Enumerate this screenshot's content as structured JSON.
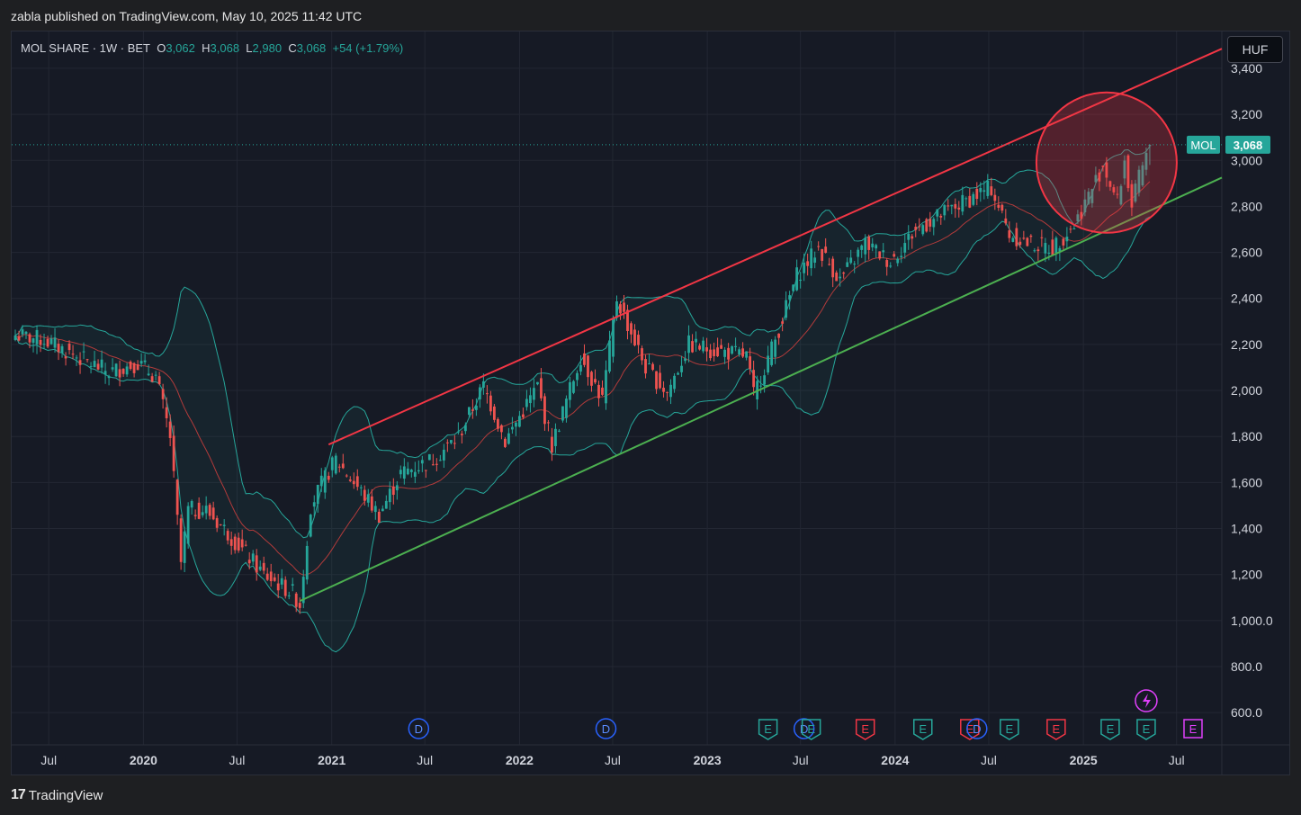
{
  "header": {
    "published": "zabla published on TradingView.com, May 10, 2025 11:42 UTC"
  },
  "legend": {
    "symbol": "MOL SHARE · 1W · BET",
    "o_label": "O",
    "o": "3,062",
    "h_label": "H",
    "h": "3,068",
    "l_label": "L",
    "l": "2,980",
    "c_label": "C",
    "c": "3,068",
    "change": "+54 (+1.79%)"
  },
  "currency_button": "HUF",
  "price_tag": {
    "symbol": "MOL",
    "value": "3,068"
  },
  "brand": "TradingView",
  "colors": {
    "up": "#26a69a",
    "down": "#ef5350",
    "channel_top": "#f23645",
    "channel_bottom": "#4caf50",
    "bands": "#26a69a",
    "mid": "#b23b3b",
    "circle": "#f23645"
  },
  "chart_data": {
    "type": "candlestick",
    "interval": "1W",
    "ylim": [
      460,
      3560
    ],
    "y_ticks": [
      600,
      800,
      1000,
      1200,
      1400,
      1600,
      1800,
      2000,
      2200,
      2400,
      2600,
      2800,
      3000,
      3200,
      3400
    ],
    "y_tick_labels": [
      "600.0",
      "800.0",
      "1,000.0",
      "1,200",
      "1,400",
      "1,600",
      "1,800",
      "2,000",
      "2,200",
      "2,400",
      "2,600",
      "2,800",
      "3,000",
      "3,200",
      "3,400"
    ],
    "x_range": [
      "2019-04-20",
      "2025-09-27"
    ],
    "x_ticks": [
      {
        "date": "2019-07-01",
        "label": "Jul",
        "bold": false
      },
      {
        "date": "2020-01-01",
        "label": "2020",
        "bold": true
      },
      {
        "date": "2020-07-01",
        "label": "Jul",
        "bold": false
      },
      {
        "date": "2021-01-01",
        "label": "2021",
        "bold": true
      },
      {
        "date": "2021-07-01",
        "label": "Jul",
        "bold": false
      },
      {
        "date": "2022-01-01",
        "label": "2022",
        "bold": true
      },
      {
        "date": "2022-07-01",
        "label": "Jul",
        "bold": false
      },
      {
        "date": "2023-01-01",
        "label": "2023",
        "bold": true
      },
      {
        "date": "2023-07-01",
        "label": "Jul",
        "bold": false
      },
      {
        "date": "2024-01-01",
        "label": "2024",
        "bold": true
      },
      {
        "date": "2024-07-01",
        "label": "Jul",
        "bold": false
      },
      {
        "date": "2025-01-01",
        "label": "2025",
        "bold": true
      },
      {
        "date": "2025-07-01",
        "label": "Jul",
        "bold": false
      }
    ],
    "price_path": [
      [
        "2019-04-27",
        2240
      ],
      [
        "2019-06-22",
        2220
      ],
      [
        "2019-08-31",
        2140
      ],
      [
        "2019-10-26",
        2080
      ],
      [
        "2019-12-21",
        2120
      ],
      [
        "2020-01-25",
        2060
      ],
      [
        "2020-02-22",
        1800
      ],
      [
        "2020-03-14",
        1250
      ],
      [
        "2020-03-28",
        1480
      ],
      [
        "2020-05-02",
        1480
      ],
      [
        "2020-06-13",
        1380
      ],
      [
        "2020-08-22",
        1200
      ],
      [
        "2020-10-17",
        1120
      ],
      [
        "2020-10-31",
        1070
      ],
      [
        "2020-11-21",
        1500
      ],
      [
        "2020-12-19",
        1620
      ],
      [
        "2021-01-09",
        1700
      ],
      [
        "2021-03-13",
        1520
      ],
      [
        "2021-04-03",
        1460
      ],
      [
        "2021-05-15",
        1640
      ],
      [
        "2021-07-17",
        1700
      ],
      [
        "2021-09-04",
        1800
      ],
      [
        "2021-10-23",
        2020
      ],
      [
        "2021-12-04",
        1780
      ],
      [
        "2022-02-05",
        2020
      ],
      [
        "2022-03-05",
        1760
      ],
      [
        "2022-04-30",
        2150
      ],
      [
        "2022-06-11",
        1960
      ],
      [
        "2022-07-09",
        2400
      ],
      [
        "2022-09-03",
        2100
      ],
      [
        "2022-10-15",
        1990
      ],
      [
        "2022-11-26",
        2200
      ],
      [
        "2023-01-07",
        2180
      ],
      [
        "2023-03-18",
        2150
      ],
      [
        "2023-04-01",
        1980
      ],
      [
        "2023-05-13",
        2220
      ],
      [
        "2023-06-24",
        2500
      ],
      [
        "2023-08-05",
        2620
      ],
      [
        "2023-09-16",
        2480
      ],
      [
        "2023-11-04",
        2640
      ],
      [
        "2023-12-23",
        2560
      ],
      [
        "2024-02-10",
        2700
      ],
      [
        "2024-04-13",
        2780
      ],
      [
        "2024-06-15",
        2860
      ],
      [
        "2024-07-06",
        2880
      ],
      [
        "2024-08-10",
        2680
      ],
      [
        "2024-09-14",
        2640
      ],
      [
        "2024-11-02",
        2620
      ],
      [
        "2024-12-14",
        2720
      ],
      [
        "2025-01-18",
        2880
      ],
      [
        "2025-02-08",
        2980
      ],
      [
        "2025-03-08",
        2820
      ],
      [
        "2025-03-22",
        3000
      ],
      [
        "2025-04-05",
        2800
      ],
      [
        "2025-04-19",
        2920
      ],
      [
        "2025-05-10",
        3068
      ]
    ],
    "last": {
      "open": 3062,
      "high": 3068,
      "low": 2980,
      "close": 3068,
      "change": 54,
      "change_pct": 1.79
    },
    "annotations": {
      "channel_top": [
        [
          "2020-12-26",
          1765
        ],
        [
          "2025-09-27",
          3485
        ]
      ],
      "channel_bottom": [
        [
          "2020-10-31",
          1085
        ],
        [
          "2025-09-27",
          2925
        ]
      ],
      "circle_center": [
        "2025-02-15",
        2990
      ],
      "events": [
        {
          "date": "2021-06-19",
          "type": "D"
        },
        {
          "date": "2022-06-18",
          "type": "D"
        },
        {
          "date": "2023-04-29",
          "type": "E"
        },
        {
          "date": "2023-07-08",
          "type": "D"
        },
        {
          "date": "2023-07-22",
          "type": "E"
        },
        {
          "date": "2023-11-04",
          "type": "E"
        },
        {
          "date": "2024-02-24",
          "type": "E"
        },
        {
          "date": "2024-05-25",
          "type": "E"
        },
        {
          "date": "2024-06-08",
          "type": "D"
        },
        {
          "date": "2024-08-10",
          "type": "E"
        },
        {
          "date": "2024-11-09",
          "type": "E"
        },
        {
          "date": "2025-02-22",
          "type": "E"
        },
        {
          "date": "2025-05-03",
          "type": "E"
        },
        {
          "date": "2025-05-03",
          "type": "split"
        },
        {
          "date": "2025-08-02",
          "type": "E"
        }
      ]
    }
  }
}
